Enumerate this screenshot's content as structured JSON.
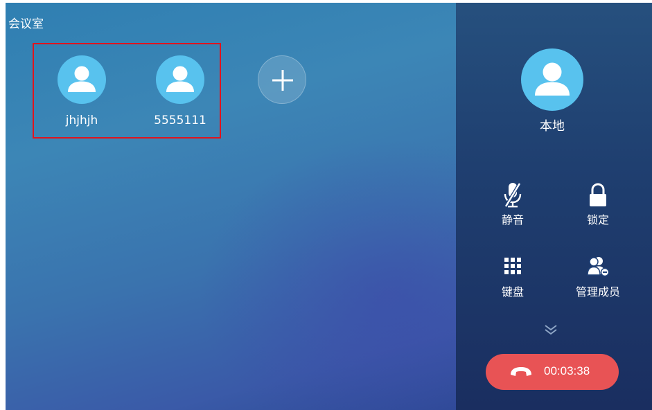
{
  "room": {
    "title": "会议室"
  },
  "participants": [
    {
      "name": "jhjhjh"
    },
    {
      "name": "5555111"
    }
  ],
  "self": {
    "name": "本地"
  },
  "controls": {
    "mute": "静音",
    "lock": "锁定",
    "keypad": "键盘",
    "manage": "管理成员"
  },
  "call": {
    "timer": "00:03:38"
  },
  "colors": {
    "avatar": "#58c2ee",
    "end_call": "#e85355",
    "highlight_border": "#e0141e"
  },
  "icons": [
    "user-icon",
    "plus-icon",
    "mic-off-icon",
    "lock-icon",
    "keypad-icon",
    "manage-members-icon",
    "chevron-down-icon",
    "hang-up-icon"
  ]
}
